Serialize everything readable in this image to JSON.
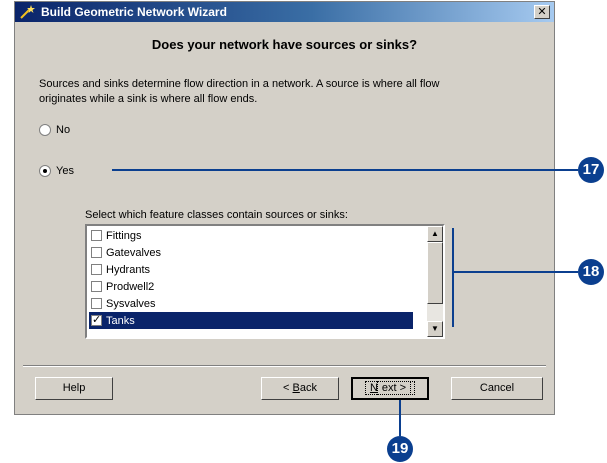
{
  "window": {
    "title": "Build Geometric Network Wizard",
    "close_label": "✕"
  },
  "heading": "Does your network have sources or sinks?",
  "description": "Sources and sinks determine flow direction in a network. A source is where all flow originates while a sink is where all flow ends.",
  "options": [
    {
      "label": "No",
      "selected": false
    },
    {
      "label": "Yes",
      "selected": true
    }
  ],
  "list": {
    "label": "Select which feature classes contain sources or sinks:",
    "items": [
      {
        "label": "Fittings",
        "checked": false
      },
      {
        "label": "Gatevalves",
        "checked": false
      },
      {
        "label": "Hydrants",
        "checked": false
      },
      {
        "label": "Prodwell2",
        "checked": false
      },
      {
        "label": "Sysvalves",
        "checked": false
      },
      {
        "label": "Tanks",
        "checked": true,
        "selected": true
      }
    ]
  },
  "buttons": {
    "help": "Help",
    "back_prefix": "< ",
    "back_key": "B",
    "back_rest": "ack",
    "next_key": "N",
    "next_rest": "ext >",
    "cancel": "Cancel"
  },
  "callouts": {
    "yes_option": "17",
    "feature_list": "18",
    "next_button": "19"
  },
  "colors": {
    "callout": "#0b3f8f",
    "title_bar": "#0a246a",
    "selection": "#0a246a"
  }
}
